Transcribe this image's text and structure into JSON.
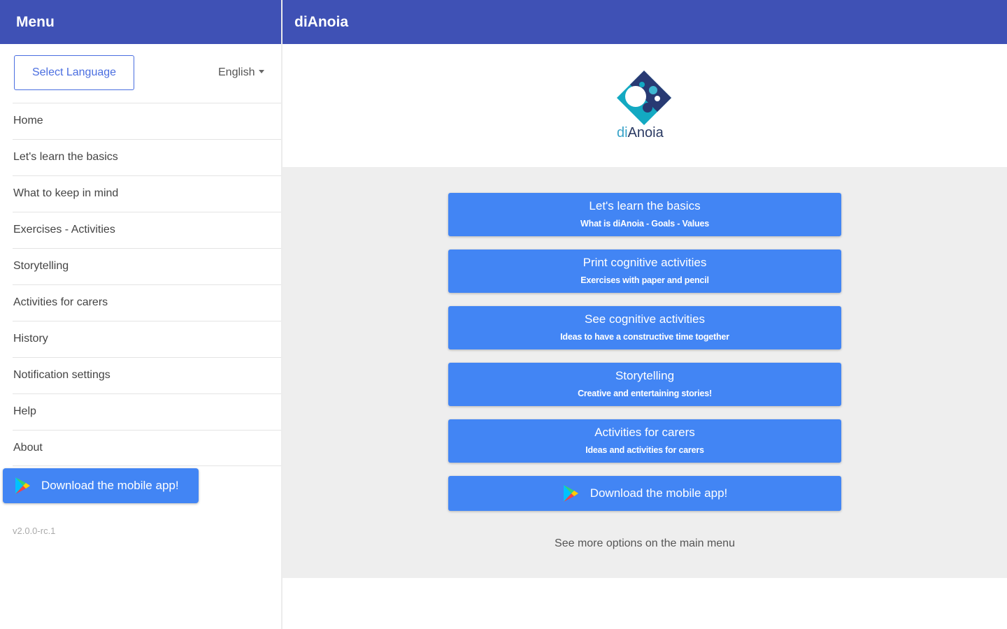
{
  "sidebar": {
    "title": "Menu",
    "select_language_label": "Select Language",
    "language_value": "English",
    "items": [
      {
        "label": "Home"
      },
      {
        "label": "Let's learn the basics"
      },
      {
        "label": "What to keep in mind"
      },
      {
        "label": "Exercises - Activities"
      },
      {
        "label": "Storytelling"
      },
      {
        "label": "Activities for carers"
      },
      {
        "label": "History"
      },
      {
        "label": "Notification settings"
      },
      {
        "label": "Help"
      },
      {
        "label": "About"
      }
    ],
    "download_label": "Download the mobile app!",
    "download_icon": "google-play-icon",
    "version": "v2.0.0-rc.1"
  },
  "main": {
    "title": "diAnoia",
    "logo": {
      "prefix": "di",
      "suffix": "Anoia"
    },
    "cards": [
      {
        "title": "Let's learn the basics",
        "subtitle": "What is diAnoia - Goals - Values"
      },
      {
        "title": "Print cognitive activities",
        "subtitle": "Exercises with paper and pencil"
      },
      {
        "title": "See cognitive activities",
        "subtitle": "Ideas to have a constructive time together"
      },
      {
        "title": "Storytelling",
        "subtitle": "Creative and entertaining stories!"
      },
      {
        "title": "Activities for carers",
        "subtitle": "Ideas and activities for carers"
      }
    ],
    "download_label": "Download the mobile app!",
    "see_more": "See more options on the main menu"
  },
  "colors": {
    "header": "#3f51b5",
    "button": "#4285f4",
    "content_bg": "#eeeeee",
    "outline_button": "#4a6ee0"
  }
}
